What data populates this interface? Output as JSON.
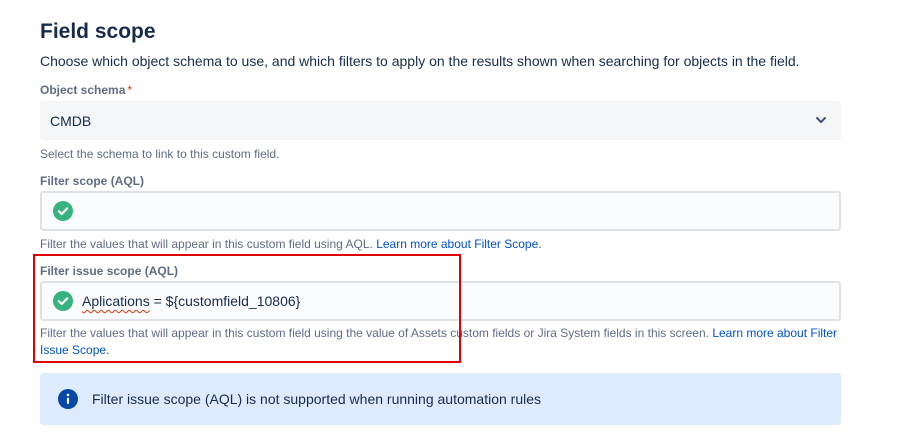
{
  "section": {
    "title": "Field scope",
    "description": "Choose which object schema to use, and which filters to apply on the results shown when searching for objects in the field."
  },
  "object_schema": {
    "label": "Object schema",
    "required_marker": "*",
    "value": "CMDB",
    "help": "Select the schema to link to this custom field."
  },
  "filter_scope": {
    "label": "Filter scope (AQL)",
    "value": "",
    "help": "Filter the values that will appear in this custom field using AQL.",
    "help_link": "Learn more about Filter Scope."
  },
  "filter_issue_scope": {
    "label": "Filter issue scope (AQL)",
    "value_misspelled": "Aplications",
    "value_rest": " = ${customfield_10806}",
    "help": "Filter the values that will appear in this custom field using the value of Assets custom fields or Jira System fields in this screen.",
    "help_link": "Learn more about Filter Issue Scope."
  },
  "banner": {
    "message": "Filter issue scope (AQL) is not supported when running automation rules"
  },
  "colors": {
    "accent": "#0052cc",
    "success": "#36b37e",
    "required": "#de350b",
    "highlight": "#e00000",
    "info_bg": "#deebff"
  }
}
